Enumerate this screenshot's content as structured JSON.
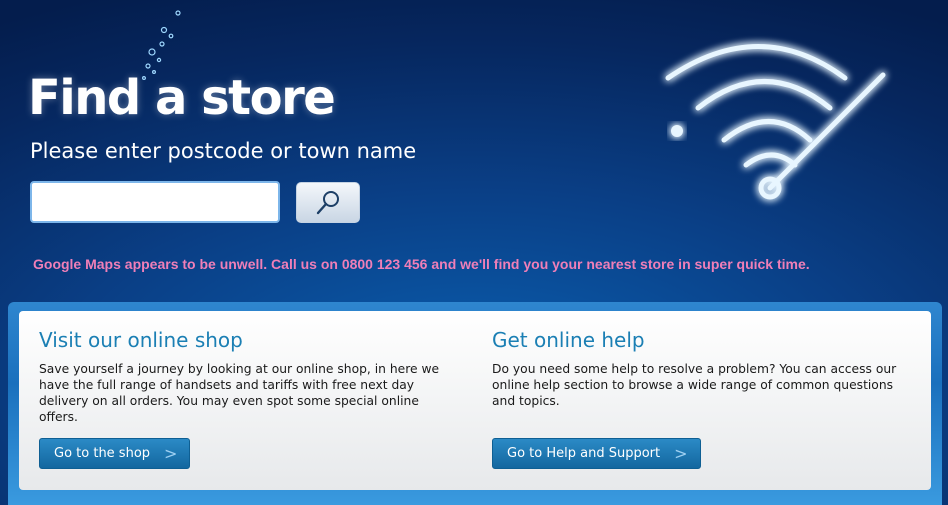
{
  "hero": {
    "title": "Find a store",
    "prompt": "Please enter postcode or town name",
    "search_value": "",
    "search_icon": "magnifier-icon",
    "error_message": "Google Maps appears to be unwell. Call us on 0800 123 456 and we'll find you your nearest store in super quick time."
  },
  "promo": {
    "shop": {
      "title": "Visit our online shop",
      "body": "Save yourself a journey by looking at our online shop, in here we have the full range of handsets and tariffs with free next day delivery on all orders. You may even spot some special online offers.",
      "button_label": "Go to the shop",
      "button_chevron": ">"
    },
    "help": {
      "title": "Get online help",
      "body": "Do you need some help to resolve a problem? You can access our online help section to browse a wide range of common questions and topics.",
      "button_label": "Go to Help and Support",
      "button_chevron": ">"
    }
  },
  "colors": {
    "background": "#06275f",
    "heading_accent": "#1b7fb4",
    "error_text": "#f07fb8",
    "button": "#13679f"
  }
}
